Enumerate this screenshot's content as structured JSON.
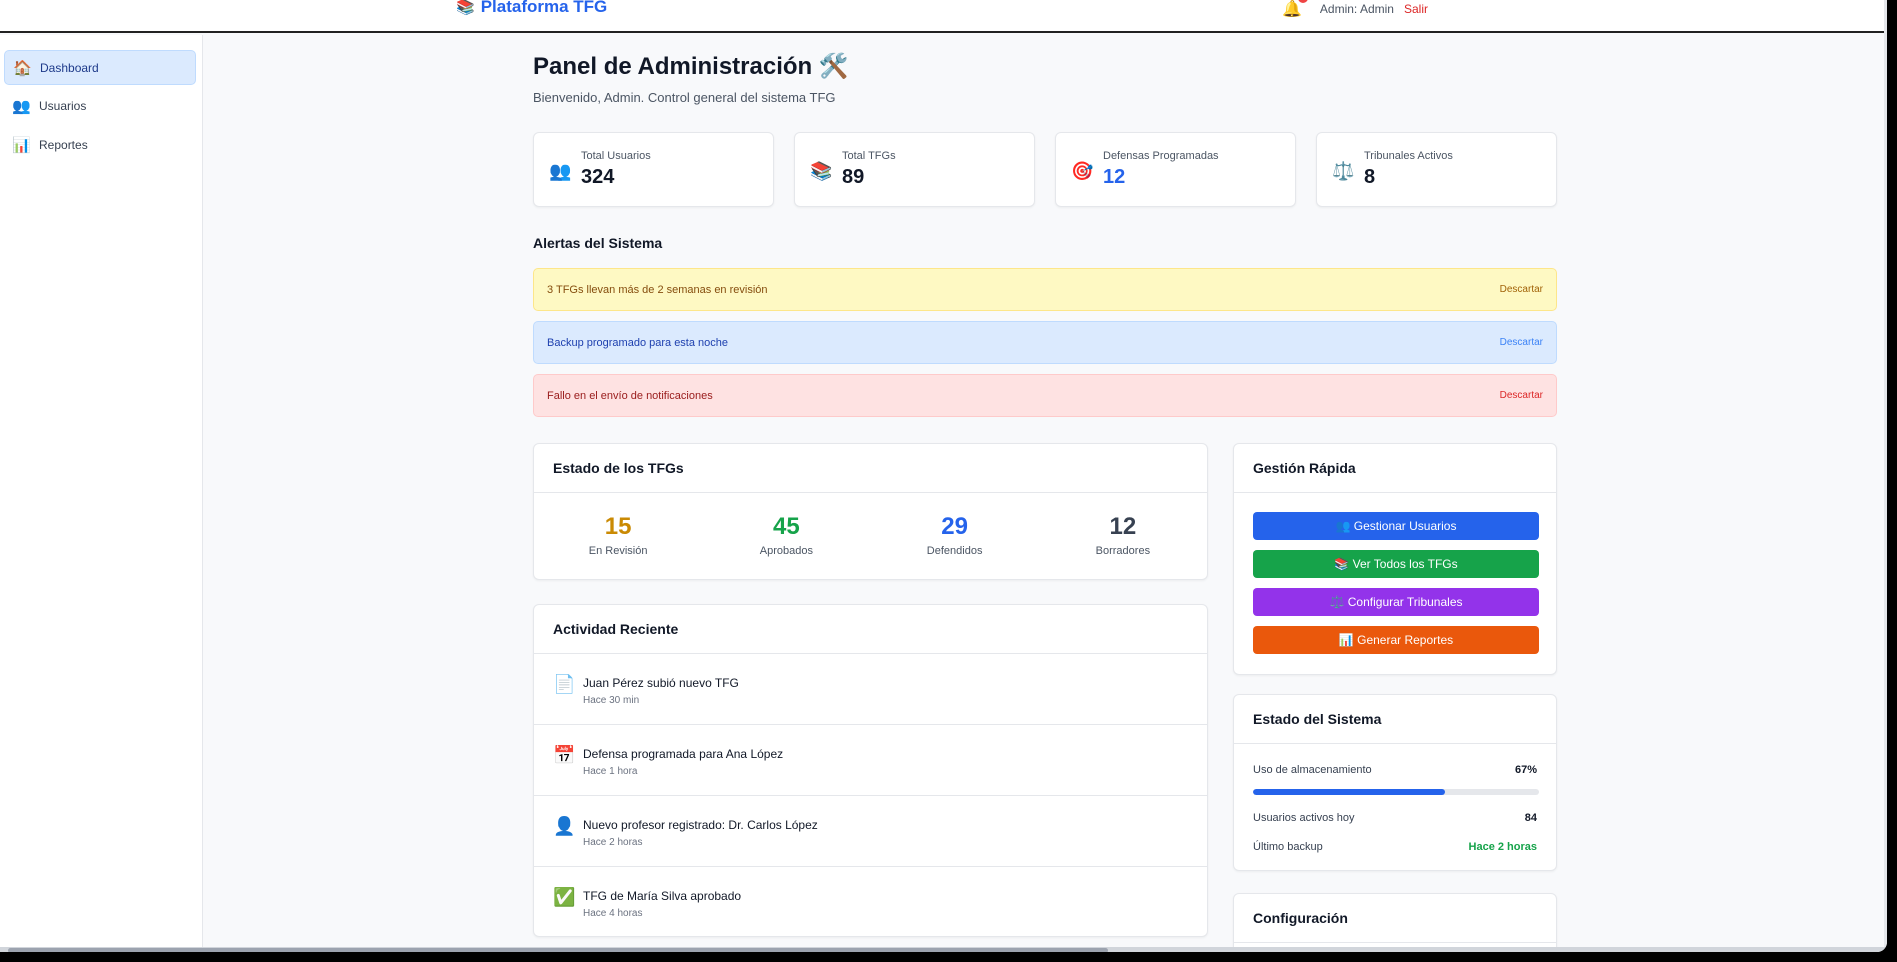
{
  "header": {
    "brand_icon": "📚",
    "brand": "Plataforma TFG",
    "bell_icon": "🔔",
    "user_label": "Admin: Admin",
    "logout": "Salir"
  },
  "sidebar": {
    "items": [
      {
        "icon": "🏠",
        "label": "Dashboard",
        "active": true
      },
      {
        "icon": "👥",
        "label": "Usuarios",
        "active": false
      },
      {
        "icon": "📊",
        "label": "Reportes",
        "active": false
      }
    ]
  },
  "page": {
    "title": "Panel de Administración 🛠️",
    "subtitle": "Bienvenido, Admin. Control general del sistema TFG"
  },
  "stats": [
    {
      "icon": "👥",
      "label": "Total Usuarios",
      "value": "324",
      "color": "#111827"
    },
    {
      "icon": "📚",
      "label": "Total TFGs",
      "value": "89",
      "color": "#111827"
    },
    {
      "icon": "🎯",
      "label": "Defensas Programadas",
      "value": "12",
      "color": "#2563eb"
    },
    {
      "icon": "⚖️",
      "label": "Tribunales Activos",
      "value": "8",
      "color": "#111827"
    }
  ],
  "alerts": {
    "title": "Alertas del Sistema",
    "items": [
      {
        "type": "warn",
        "text": "3 TFGs llevan más de 2 semanas en revisión",
        "action": "Descartar"
      },
      {
        "type": "info",
        "text": "Backup programado para esta noche",
        "action": "Descartar"
      },
      {
        "type": "error",
        "text": "Fallo en el envío de notificaciones",
        "action": "Descartar"
      }
    ]
  },
  "tfg_status": {
    "title": "Estado de los TFGs",
    "items": [
      {
        "value": "15",
        "label": "En Revisión",
        "color": "#ca8a04"
      },
      {
        "value": "45",
        "label": "Aprobados",
        "color": "#16a34a"
      },
      {
        "value": "29",
        "label": "Defendidos",
        "color": "#2563eb"
      },
      {
        "value": "12",
        "label": "Borradores",
        "color": "#374151"
      }
    ]
  },
  "activity": {
    "title": "Actividad Reciente",
    "items": [
      {
        "icon": "📄",
        "text": "Juan Pérez subió nuevo TFG",
        "time": "Hace 30 min"
      },
      {
        "icon": "📅",
        "text": "Defensa programada para Ana López",
        "time": "Hace 1 hora"
      },
      {
        "icon": "👤",
        "text": "Nuevo profesor registrado: Dr. Carlos López",
        "time": "Hace 2 horas"
      },
      {
        "icon": "✅",
        "text": "TFG de María Silva aprobado",
        "time": "Hace 4 horas"
      }
    ]
  },
  "quick": {
    "title": "Gestión Rápida",
    "buttons": [
      {
        "label": "👥 Gestionar Usuarios",
        "color": "#2563eb"
      },
      {
        "label": "📚 Ver Todos los TFGs",
        "color": "#16a34a"
      },
      {
        "label": "⚖️ Configurar Tribunales",
        "color": "#9333ea"
      },
      {
        "label": "📊 Generar Reportes",
        "color": "#ea580c"
      }
    ]
  },
  "system": {
    "title": "Estado del Sistema",
    "storage_label": "Uso de almacenamiento",
    "storage_value": "67%",
    "storage_fraction": 0.67,
    "active_label": "Usuarios activos hoy",
    "active_value": "84",
    "backup_label": "Último backup",
    "backup_value": "Hace 2 horas",
    "backup_color": "#16a34a"
  },
  "config": {
    "title": "Configuración"
  }
}
